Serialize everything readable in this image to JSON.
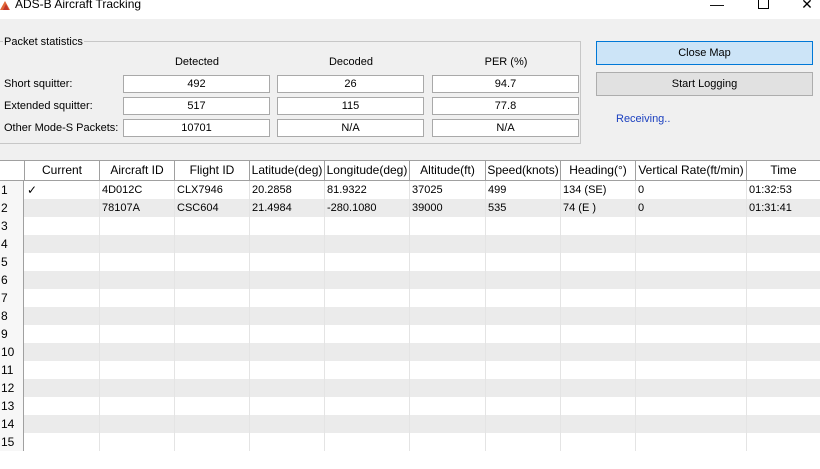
{
  "window": {
    "title": "ADS-B Aircraft Tracking",
    "minimize": "—",
    "close": "✕"
  },
  "stats": {
    "group_title": "Packet statistics",
    "columns": [
      "Detected",
      "Decoded",
      "PER (%)"
    ],
    "rows": [
      {
        "label": "Short squitter:",
        "values": [
          "492",
          "26",
          "94.7"
        ]
      },
      {
        "label": "Extended squitter:",
        "values": [
          "517",
          "115",
          "77.8"
        ]
      },
      {
        "label": "Other Mode-S Packets:",
        "values": [
          "10701",
          "N/A",
          "N/A"
        ]
      }
    ]
  },
  "controls": {
    "close_map": "Close Map",
    "start_logging": "Start Logging",
    "status": "Receiving.."
  },
  "table": {
    "columns": [
      "Current",
      "Aircraft ID",
      "Flight ID",
      "Latitude(deg)",
      "Longitude(deg)",
      "Altitude(ft)",
      "Speed(knots)",
      "Heading(°)",
      "Vertical Rate(ft/min)",
      "Time"
    ],
    "row_numbers": [
      "1",
      "2",
      "3",
      "4",
      "5",
      "6",
      "7",
      "8",
      "9",
      "10",
      "11",
      "12",
      "13",
      "14",
      "15"
    ],
    "rows": [
      [
        "✓",
        "4D012C",
        "CLX7946",
        "20.2858",
        "81.9322",
        "37025",
        "499",
        "134 (SE)",
        "0",
        "01:32:53"
      ],
      [
        "",
        "78107A",
        "CSC604",
        "21.4984",
        "-280.1080",
        "39000",
        "535",
        "74 (E )",
        "0",
        "01:31:41"
      ]
    ]
  }
}
